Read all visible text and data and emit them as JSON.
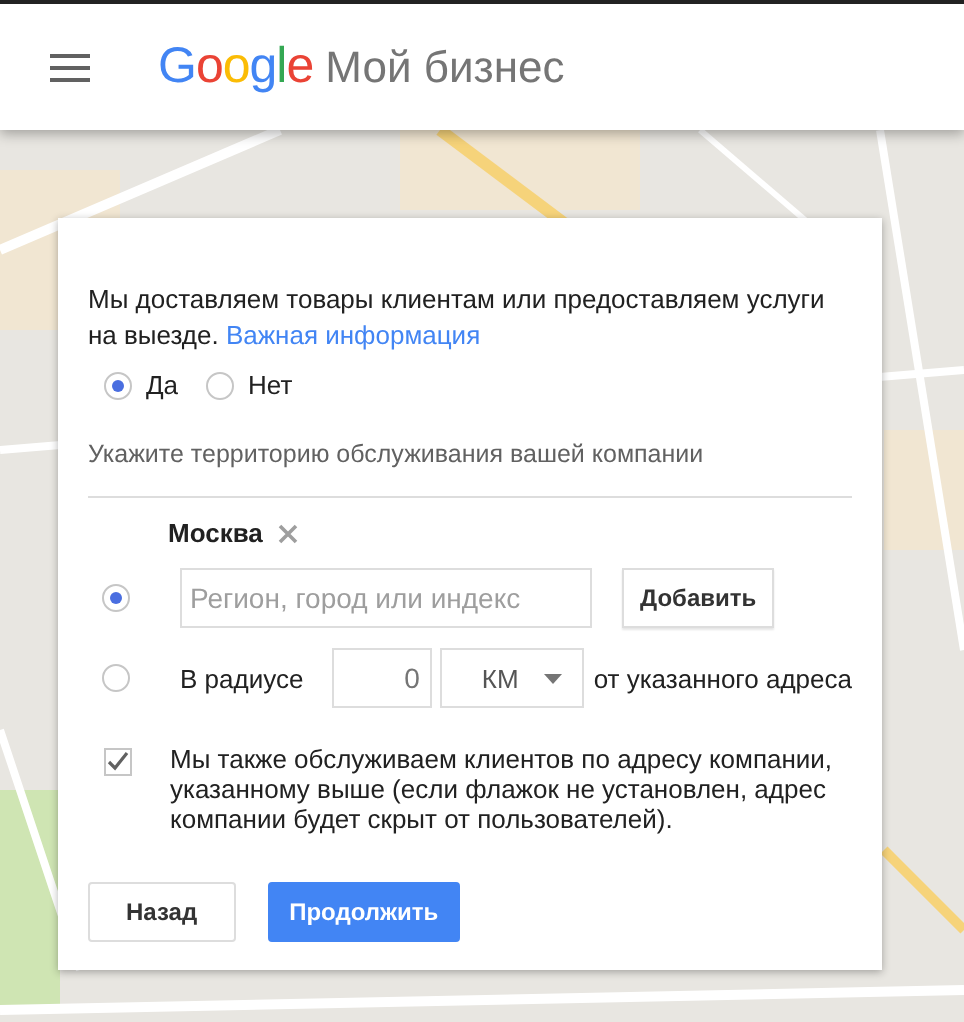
{
  "header": {
    "logo": "Google",
    "product": "Мой бизнес"
  },
  "delivery_question": {
    "text": "Мы доставляем товары клиентам или предоставляем услуги на выезде.",
    "link": "Важная информация"
  },
  "delivery_options": [
    {
      "label": "Да",
      "selected": true
    },
    {
      "label": "Нет",
      "selected": false
    }
  ],
  "area_hint": "Укажите территорию обслуживания вашей компании",
  "selected_areas": [
    {
      "name": "Москва"
    }
  ],
  "area_modes": [
    {
      "kind": "search",
      "selected": true,
      "placeholder": "Регион, город или индекс",
      "button": "Добавить"
    },
    {
      "kind": "radius",
      "selected": false,
      "label": "В радиусе",
      "value": "0",
      "unit": "КМ",
      "suffix": "от указанного адреса"
    }
  ],
  "also_serve": {
    "checked": true,
    "text": "Мы также обслуживаем клиентов по адресу компании, указанному выше (если флажок не установлен, адрес компании будет скрыт от пользователей)."
  },
  "buttons": [
    {
      "label": "Назад",
      "kind": "secondary"
    },
    {
      "label": "Продолжить",
      "kind": "primary"
    }
  ]
}
